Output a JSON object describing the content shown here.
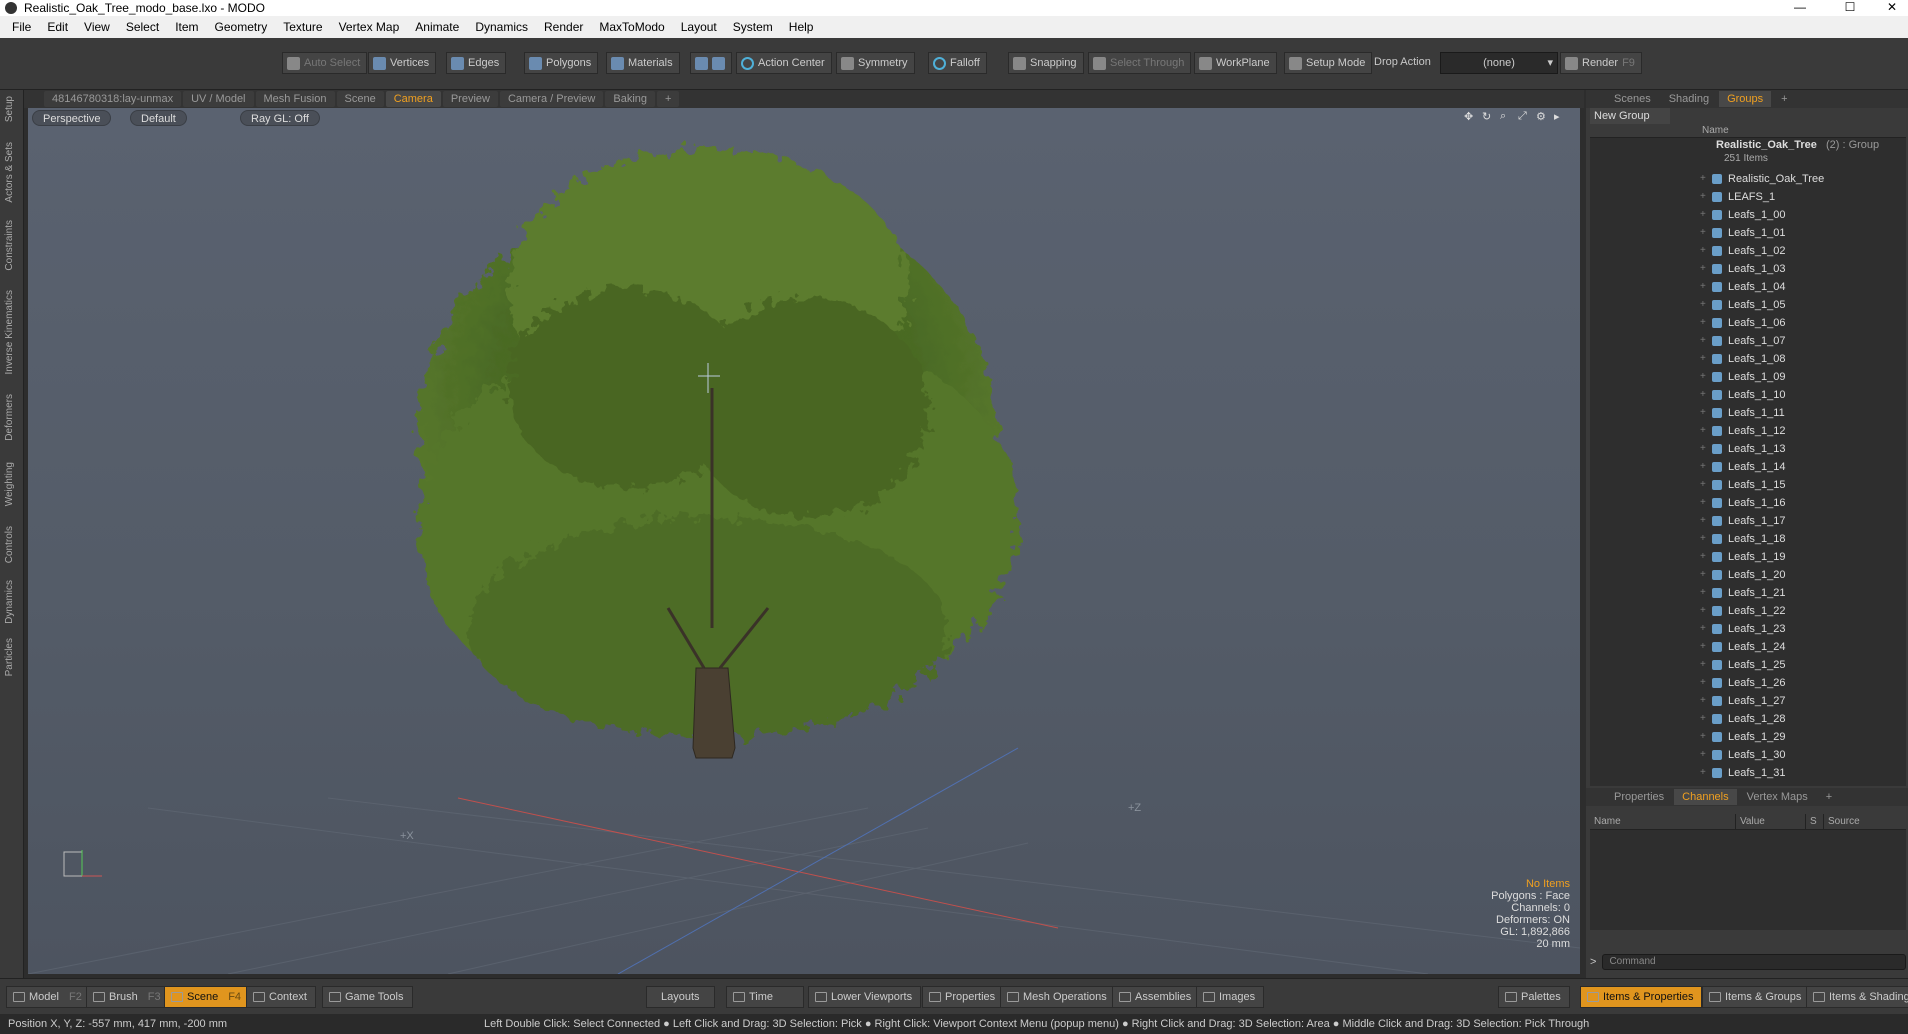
{
  "window": {
    "title": "Realistic_Oak_Tree_modo_base.lxo - MODO",
    "minimize": "—",
    "maximize": "☐",
    "close": "✕"
  },
  "menu": [
    "File",
    "Edit",
    "View",
    "Select",
    "Item",
    "Geometry",
    "Texture",
    "Vertex Map",
    "Animate",
    "Dynamics",
    "Render",
    "MaxToModo",
    "Layout",
    "System",
    "Help"
  ],
  "toolbar": {
    "auto_select": "Auto Select",
    "vertices": "Vertices",
    "edges": "Edges",
    "polygons": "Polygons",
    "materials": "Materials",
    "action_center": "Action Center",
    "symmetry": "Symmetry",
    "falloff": "Falloff",
    "snapping": "Snapping",
    "select_through": "Select Through",
    "workplane": "WorkPlane",
    "setup_mode": "Setup Mode",
    "drop_action": "Drop Action",
    "drop_value": "(none)",
    "render": "Render",
    "render_key": "F9"
  },
  "left_tabs": [
    "Setup",
    "Actors & Sets",
    "Constraints",
    "Inverse Kinematics",
    "Deformers",
    "Weighting",
    "Controls",
    "Dynamics",
    "Particles"
  ],
  "viewport_tabs": [
    "48146780318:lay-unmax",
    "UV / Model",
    "Mesh Fusion",
    "Scene",
    "Camera",
    "Preview",
    "Camera / Preview",
    "Baking",
    "+"
  ],
  "viewport": {
    "perspective": "Perspective",
    "default": "Default",
    "raygl": "Ray GL: Off",
    "info": {
      "items": "No Items",
      "polygons": "Polygons : Face",
      "channels": "Channels: 0",
      "deformers": "Deformers: ON",
      "gl": "GL: 1,892,866",
      "scale": "20 mm"
    },
    "axis_x": "+X",
    "axis_z": "+Z"
  },
  "right_tabs": [
    "Scenes",
    "Shading",
    "Groups",
    "+"
  ],
  "groups": {
    "new_group": "New Group",
    "col_name": "Name",
    "group_name": "Realistic_Oak_Tree",
    "group_suffix": "(2) : Group",
    "group_count": "251 Items",
    "items": [
      "Realistic_Oak_Tree",
      "LEAFS_1",
      "Leafs_1_00",
      "Leafs_1_01",
      "Leafs_1_02",
      "Leafs_1_03",
      "Leafs_1_04",
      "Leafs_1_05",
      "Leafs_1_06",
      "Leafs_1_07",
      "Leafs_1_08",
      "Leafs_1_09",
      "Leafs_1_10",
      "Leafs_1_11",
      "Leafs_1_12",
      "Leafs_1_13",
      "Leafs_1_14",
      "Leafs_1_15",
      "Leafs_1_16",
      "Leafs_1_17",
      "Leafs_1_18",
      "Leafs_1_19",
      "Leafs_1_20",
      "Leafs_1_21",
      "Leafs_1_22",
      "Leafs_1_23",
      "Leafs_1_24",
      "Leafs_1_25",
      "Leafs_1_26",
      "Leafs_1_27",
      "Leafs_1_28",
      "Leafs_1_29",
      "Leafs_1_30",
      "Leafs_1_31"
    ]
  },
  "props_tabs": [
    "Properties",
    "Channels",
    "Vertex Maps",
    "+"
  ],
  "channels": {
    "name": "Name",
    "value": "Value",
    "s": "S",
    "source": "Source"
  },
  "command": {
    "prompt": ">",
    "placeholder": "Command"
  },
  "bottom": {
    "model": "Model",
    "model_key": "F2",
    "brush": "Brush",
    "brush_key": "F3",
    "scene": "Scene",
    "scene_key": "F4",
    "context": "Context",
    "game_tools": "Game Tools",
    "layouts": "Layouts",
    "time": "Time",
    "lower_viewports": "Lower Viewports",
    "properties": "Properties",
    "mesh_operations": "Mesh Operations",
    "assemblies": "Assemblies",
    "images": "Images",
    "palettes": "Palettes",
    "items_properties": "Items & Properties",
    "items_groups": "Items & Groups",
    "items_shading": "Items & Shading"
  },
  "status": {
    "position": "Position X, Y, Z:  -557 mm, 417 mm, -200 mm",
    "hint": "Left Double Click: Select Connected ● Left Click and Drag: 3D Selection: Pick ● Right Click: Viewport Context Menu (popup menu) ● Right Click and Drag: 3D Selection: Area ● Middle Click and Drag: 3D Selection: Pick Through"
  },
  "colors": {
    "accent": "#e0951e",
    "leaf_dark": "#3f5a1f",
    "leaf_light": "#6f8f34",
    "trunk": "#4a4032"
  }
}
